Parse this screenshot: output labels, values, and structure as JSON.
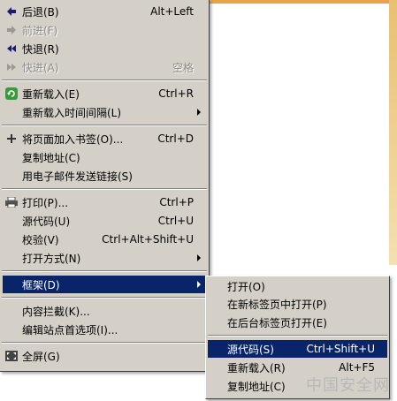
{
  "menu": {
    "back": {
      "label": "后退(B)",
      "shortcut": "Alt+Left",
      "icon": "back-arrow-icon"
    },
    "forward": {
      "label": "前进(F)",
      "icon": "forward-arrow-icon"
    },
    "rewind": {
      "label": "快退(R)",
      "icon": "rewind-icon"
    },
    "fastforward": {
      "label": "快进(A)",
      "shortcut": "空格",
      "icon": "fast-forward-icon"
    },
    "reload": {
      "label": "重新载入(E)",
      "shortcut": "Ctrl+R",
      "icon": "reload-icon"
    },
    "reload_interval": {
      "label": "重新载入时间间隔(L)"
    },
    "bookmark": {
      "label": "将页面加入书签(O)...",
      "shortcut": "Ctrl+D",
      "icon": "add-bookmark-icon"
    },
    "copy_address": {
      "label": "复制地址(C)"
    },
    "send_link": {
      "label": "用电子邮件发送链接(S)"
    },
    "print": {
      "label": "打印(P)...",
      "shortcut": "Ctrl+P",
      "icon": "printer-icon"
    },
    "source": {
      "label": "源代码(U)",
      "shortcut": "Ctrl+U"
    },
    "validate": {
      "label": "校验(V)",
      "shortcut": "Ctrl+Alt+Shift+U"
    },
    "open_with": {
      "label": "打开方式(N)"
    },
    "frame": {
      "label": "框架(D)"
    },
    "content_block": {
      "label": "内容拦截(K)..."
    },
    "site_prefs": {
      "label": "编辑站点首选项(I)..."
    },
    "fullscreen": {
      "label": "全屏(G)",
      "icon": "fullscreen-icon"
    }
  },
  "submenu": {
    "open": {
      "label": "打开(O)"
    },
    "open_new_tab": {
      "label": "在新标签页中打开(P)"
    },
    "open_bg_tab": {
      "label": "在后台标签页打开(E)"
    },
    "source": {
      "label": "源代码(S)",
      "shortcut": "Ctrl+Shift+U"
    },
    "reload": {
      "label": "重新载入(R)",
      "shortcut": "Alt+F5"
    },
    "copy_address": {
      "label": "复制地址(C)"
    }
  },
  "watermark": "中国安全网",
  "colors": {
    "highlight": "#0a246a",
    "menu_bg": "#d4d0c8",
    "disabled": "#8c8a86"
  }
}
